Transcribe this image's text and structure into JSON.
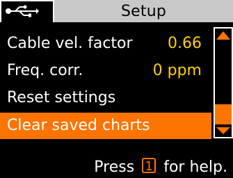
{
  "header": {
    "title": "Setup",
    "usb_icon": "usb-icon"
  },
  "menu": {
    "items": [
      {
        "label": "Cable vel. factor",
        "value": "0.66",
        "selected": false
      },
      {
        "label": "Freq. corr.",
        "value": "0 ppm",
        "selected": false
      },
      {
        "label": "Reset settings",
        "value": "",
        "selected": false
      },
      {
        "label": "Clear saved charts",
        "value": "",
        "selected": true
      }
    ]
  },
  "scrollbar": {
    "up_icon": "arrow-up-icon",
    "down_icon": "arrow-down-icon",
    "thumb_start_fraction": 0.75,
    "thumb_end_fraction": 1.0
  },
  "footer": {
    "help_prefix": "Press",
    "help_key": "1",
    "help_suffix": "for help."
  },
  "colors": {
    "accent": "#ff7300",
    "value": "#ffd000",
    "titlebar": "#c8c8c8",
    "background": "#000000",
    "text": "#ffffff"
  }
}
